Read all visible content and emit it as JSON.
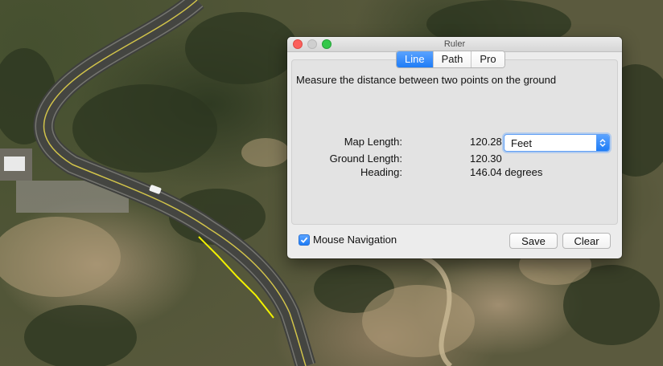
{
  "window": {
    "title": "Ruler"
  },
  "tabs": [
    {
      "label": "Line",
      "active": true
    },
    {
      "label": "Path",
      "active": false
    },
    {
      "label": "Pro",
      "active": false
    }
  ],
  "description": "Measure the distance between two points on the ground",
  "measurements": {
    "map_length_label": "Map Length:",
    "map_length_value": "120.28",
    "unit_select": {
      "selected": "Feet"
    },
    "ground_length_label": "Ground Length:",
    "ground_length_value": "120.30",
    "heading_label": "Heading:",
    "heading_value": "146.04 degrees"
  },
  "footer": {
    "mouse_navigation_label": "Mouse Navigation",
    "mouse_navigation_checked": true,
    "save_label": "Save",
    "clear_label": "Clear"
  },
  "colors": {
    "accent": "#1e7cf6",
    "measure_line": "#f2f200"
  }
}
